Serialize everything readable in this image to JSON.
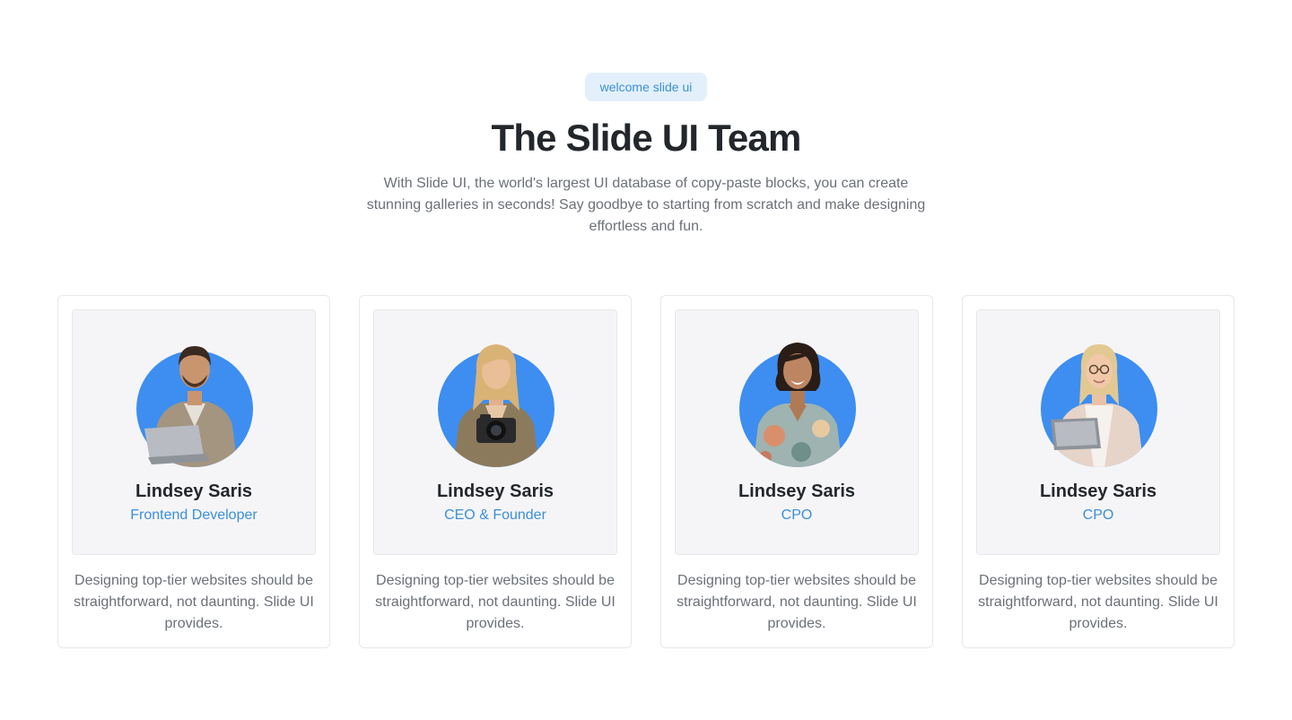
{
  "header": {
    "badge": "welcome slide ui",
    "title": "The Slide UI Team",
    "subtitle": "With Slide UI, the world's largest UI database of copy-paste blocks, you can create stunning galleries in seconds! Say goodbye to starting from scratch and make designing effortless and fun."
  },
  "colors": {
    "accent": "#3b8fd9",
    "avatar_bg": "#3d8ef0",
    "badge_bg": "#e3f0fb"
  },
  "team": [
    {
      "name": "Lindsey Saris",
      "role": "Frontend Developer",
      "description": "Designing top-tier websites should be straightforward, not daunting. Slide UI provides.",
      "avatar_icon": "man-with-laptop-avatar"
    },
    {
      "name": "Lindsey Saris",
      "role": "CEO & Founder",
      "description": "Designing top-tier websites should be straightforward, not daunting. Slide UI provides.",
      "avatar_icon": "woman-with-camera-avatar"
    },
    {
      "name": "Lindsey Saris",
      "role": "CPO",
      "description": "Designing top-tier websites should be straightforward, not daunting. Slide UI provides.",
      "avatar_icon": "woman-floral-shirt-avatar"
    },
    {
      "name": "Lindsey Saris",
      "role": "CPO",
      "description": "Designing top-tier websites should be straightforward, not daunting. Slide UI provides.",
      "avatar_icon": "woman-with-tablet-avatar"
    }
  ]
}
